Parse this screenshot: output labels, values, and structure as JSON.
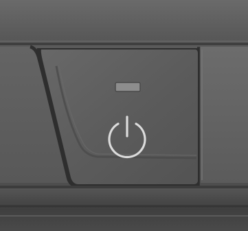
{
  "device": {
    "power_button": {
      "icon": "power-icon",
      "indicator_state": "off"
    }
  },
  "colors": {
    "chassis_top": "#626262",
    "chassis_mid": "#575757",
    "button_face": "#5e5e5e",
    "button_shadow": "#2e2e2e",
    "power_symbol": "#dcdcdc",
    "indicator_led": "#8d8d8d"
  }
}
